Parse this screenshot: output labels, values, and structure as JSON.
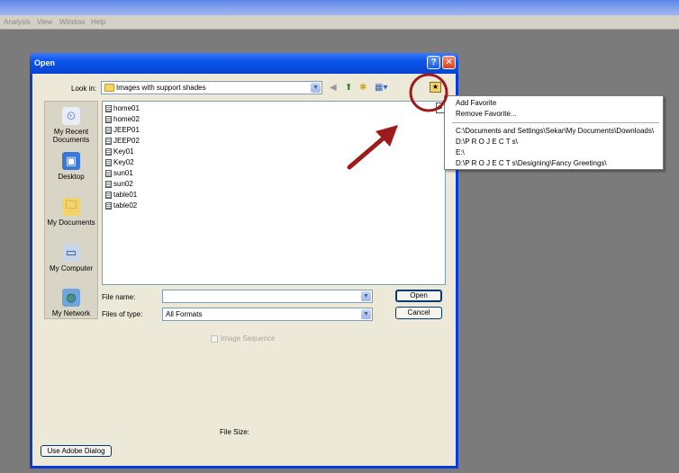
{
  "app_menu": {
    "items": [
      "Analysis",
      "View",
      "Window",
      "Help"
    ]
  },
  "dialog": {
    "title": "Open",
    "help_glyph": "?",
    "close_glyph": "✕",
    "look_in_label": "Look in:",
    "look_in_value": "Images with support shades",
    "places": [
      {
        "label": "My Recent Documents",
        "icon": "recent-documents-icon"
      },
      {
        "label": "Desktop",
        "icon": "desktop-icon"
      },
      {
        "label": "My Documents",
        "icon": "my-documents-icon"
      },
      {
        "label": "My Computer",
        "icon": "my-computer-icon"
      },
      {
        "label": "My Network",
        "icon": "my-network-icon"
      }
    ],
    "files": [
      "home01",
      "home02",
      "JEEP01",
      "JEEP02",
      "Key01",
      "Key02",
      "sun01",
      "sun02",
      "table01",
      "table02"
    ],
    "file_name_label": "File name:",
    "file_name_value": "",
    "files_of_type_label": "Files of type:",
    "files_of_type_value": "All Formats",
    "open_label": "Open",
    "cancel_label": "Cancel",
    "image_sequence_label": "Image Sequence",
    "file_size_label": "File Size:",
    "adobe_dialog_label": "Use Adobe Dialog"
  },
  "favorites_menu": {
    "add": "Add Favorite",
    "remove": "Remove Favorite...",
    "paths": [
      "C:\\Documents and Settings\\Sekar\\My Documents\\Downloads\\",
      "D:\\P R O J E C T s\\",
      "E:\\",
      "D:\\P R O J E C T s\\Designing\\Fancy Greetings\\"
    ]
  },
  "annotation": {
    "color": "#9e1b1b"
  }
}
